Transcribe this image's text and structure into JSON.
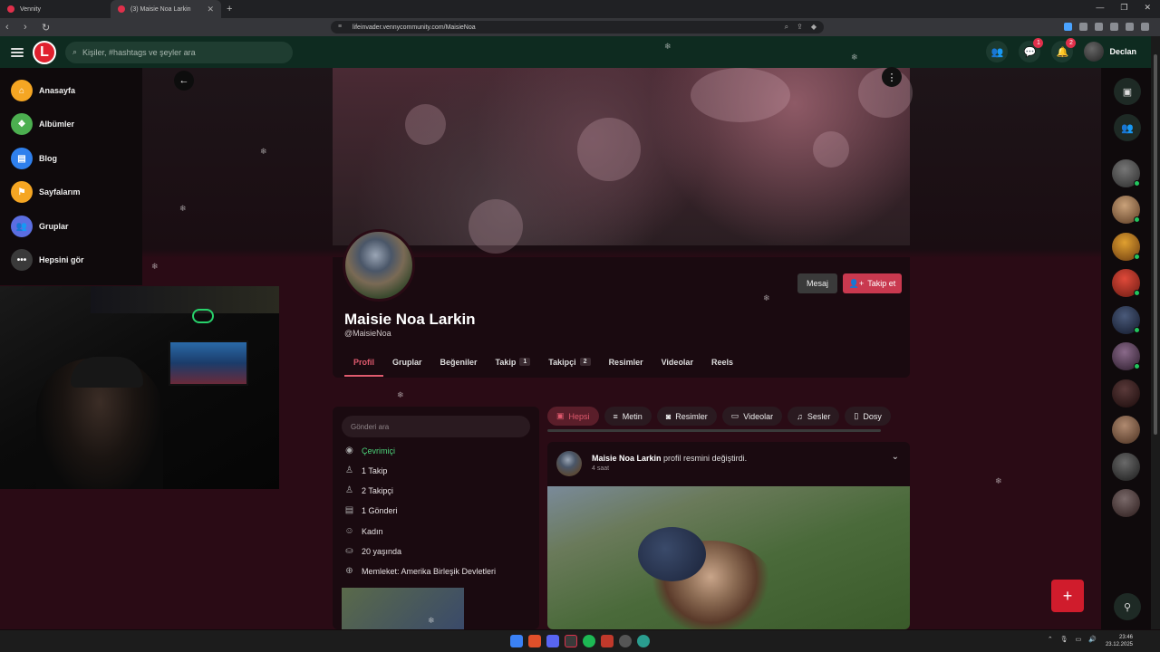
{
  "browser": {
    "tabs": [
      {
        "title": "Vennity"
      },
      {
        "title": "(3) Maisie Noa Larkin"
      }
    ],
    "url": "lifeinvader.vennycommunity.com/MaisieNoa"
  },
  "header": {
    "search_placeholder": "Kişiler, #hashtags ve şeyler ara",
    "badges": {
      "messages": "1",
      "notifications": "2"
    },
    "user_name": "Declan"
  },
  "sidebar": {
    "items": [
      {
        "label": "Anasayfa",
        "icon": "home-icon",
        "color": "#f5a623"
      },
      {
        "label": "Albümler",
        "icon": "album-icon",
        "color": "#4caf50"
      },
      {
        "label": "Blog",
        "icon": "blog-icon",
        "color": "#2f80ed"
      },
      {
        "label": "Sayfalarım",
        "icon": "flag-icon",
        "color": "#f5a623"
      },
      {
        "label": "Gruplar",
        "icon": "groups-icon",
        "color": "#5b6ee1"
      },
      {
        "label": "Hepsini gör",
        "icon": "more-icon",
        "color": "#3a3a3a"
      }
    ]
  },
  "profile": {
    "name": "Maisie Noa Larkin",
    "handle": "@MaisieNoa",
    "message_label": "Mesaj",
    "follow_label": "Takip et",
    "tabs": [
      {
        "label": "Profil",
        "count": ""
      },
      {
        "label": "Gruplar",
        "count": ""
      },
      {
        "label": "Beğeniler",
        "count": ""
      },
      {
        "label": "Takip",
        "count": "1"
      },
      {
        "label": "Takipçi",
        "count": "2"
      },
      {
        "label": "Resimler",
        "count": ""
      },
      {
        "label": "Videolar",
        "count": ""
      },
      {
        "label": "Reels",
        "count": ""
      }
    ]
  },
  "info": {
    "search_placeholder": "Gönderi ara",
    "items": [
      {
        "text": "Çevrimiçi",
        "icon": "eye-icon",
        "color": "#4cd37a"
      },
      {
        "text": "1 Takip",
        "icon": "user-icon",
        "color": ""
      },
      {
        "text": "2 Takipçi",
        "icon": "users-icon",
        "color": ""
      },
      {
        "text": "1 Gönderi",
        "icon": "post-icon",
        "color": ""
      },
      {
        "text": "Kadın",
        "icon": "gender-icon",
        "color": ""
      },
      {
        "text": "20 yaşında",
        "icon": "cake-icon",
        "color": ""
      },
      {
        "text": "Memleket: Amerika Birleşik Devletleri",
        "icon": "globe-icon",
        "color": ""
      }
    ]
  },
  "filters": [
    {
      "label": "Hepsi",
      "icon": "all-icon"
    },
    {
      "label": "Metin",
      "icon": "text-icon"
    },
    {
      "label": "Resimler",
      "icon": "camera-icon"
    },
    {
      "label": "Videolar",
      "icon": "video-icon"
    },
    {
      "label": "Sesler",
      "icon": "music-icon"
    },
    {
      "label": "Dosy",
      "icon": "file-icon"
    }
  ],
  "post": {
    "author": "Maisie Noa Larkin",
    "action": "profil resmini değiştirdi.",
    "time": "4 saat"
  },
  "taskbar": {
    "time": "23:46",
    "date": "23.12.2025"
  },
  "colors": {
    "accent": "#c9394f",
    "header": "#0e2b20",
    "fab": "#d01c2c"
  }
}
